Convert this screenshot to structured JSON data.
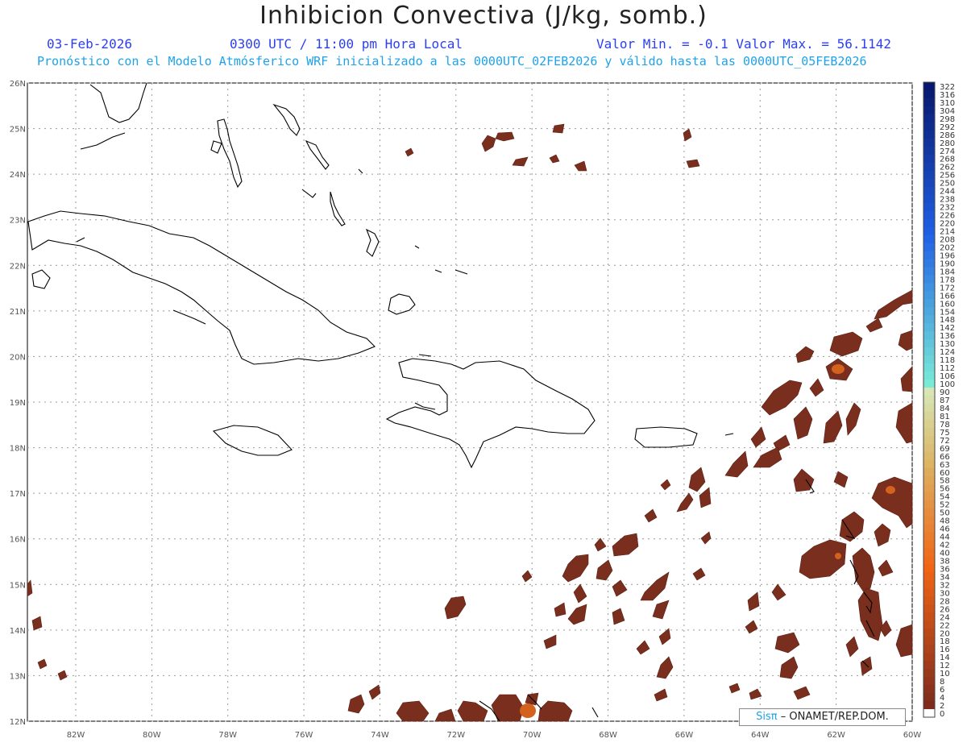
{
  "header": {
    "title": "Inhibicion Convectiva (J/kg, somb.)",
    "date": "03-Feb-2026",
    "time": "0300 UTC / 11:00 pm Hora Local",
    "minmax": "Valor Min. = -0.1  Valor Max. = 56.1142",
    "model_line": "Pronóstico con el Modelo Atmósferico WRF inicializado a las 0000UTC_02FEB2026 y válido hasta las  0000UTC_05FEB2026"
  },
  "colors": {
    "cin_dark": "#7a2e1e",
    "cin_mid": "#8c3a22",
    "cin_hot": "#d4621f",
    "coast": "#000000",
    "grid": "#999999"
  },
  "map": {
    "lat_labels": [
      "26N",
      "25N",
      "24N",
      "23N",
      "22N",
      "21N",
      "20N",
      "19N",
      "18N",
      "17N",
      "16N",
      "15N",
      "14N",
      "13N",
      "12N"
    ],
    "lon_labels": [
      "82W",
      "80W",
      "78W",
      "76W",
      "74W",
      "72W",
      "70W",
      "68W",
      "66W",
      "64W",
      "62W",
      "60W"
    ]
  },
  "colorbar": {
    "labels": [
      "322",
      "316",
      "310",
      "304",
      "298",
      "292",
      "286",
      "280",
      "274",
      "268",
      "262",
      "256",
      "250",
      "244",
      "238",
      "232",
      "226",
      "220",
      "214",
      "208",
      "202",
      "196",
      "190",
      "184",
      "178",
      "172",
      "166",
      "160",
      "154",
      "148",
      "142",
      "136",
      "130",
      "124",
      "118",
      "112",
      "106",
      "100",
      "90",
      "87",
      "84",
      "81",
      "78",
      "75",
      "72",
      "69",
      "66",
      "63",
      "60",
      "58",
      "56",
      "54",
      "52",
      "50",
      "48",
      "46",
      "44",
      "42",
      "40",
      "38",
      "36",
      "34",
      "32",
      "30",
      "28",
      "26",
      "24",
      "22",
      "20",
      "18",
      "16",
      "14",
      "12",
      "10",
      "8",
      "6",
      "4",
      "2",
      "0"
    ]
  },
  "credit": {
    "brand": "Sisπ",
    "text": "– ONAMET/REP.DOM."
  }
}
